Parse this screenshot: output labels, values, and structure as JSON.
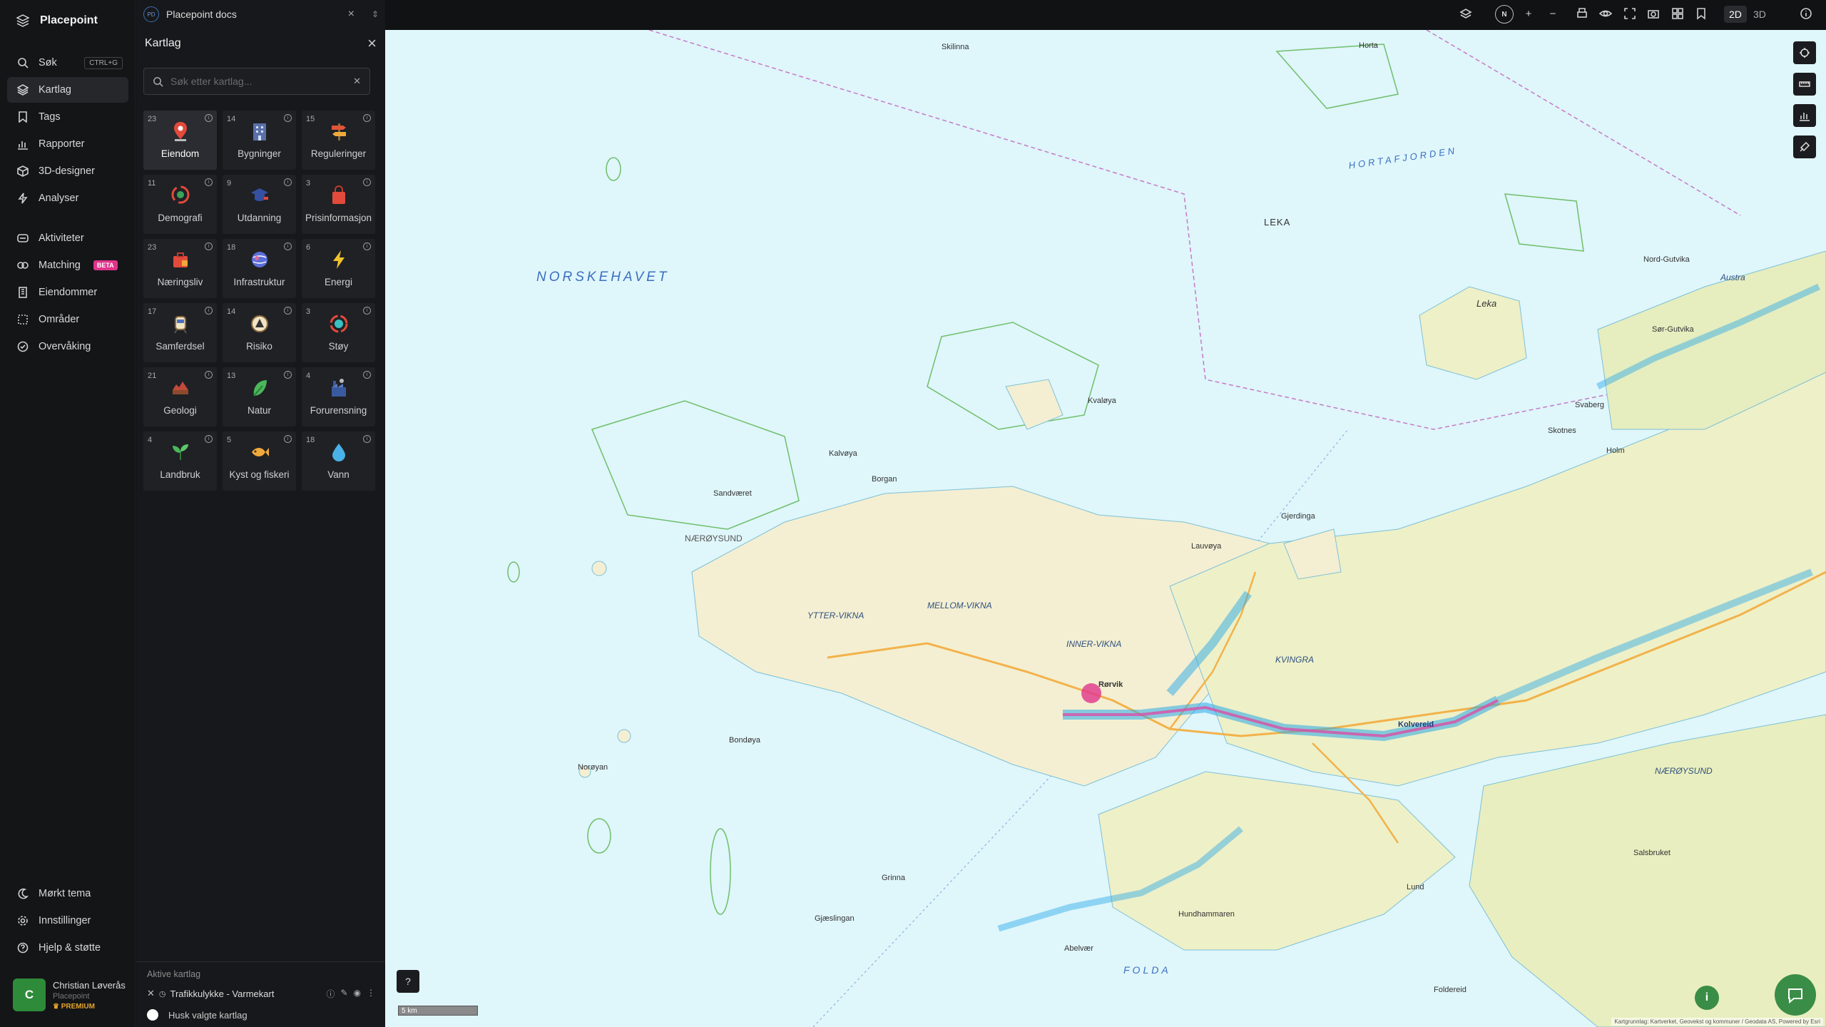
{
  "brand": {
    "name": "Placepoint"
  },
  "nav": {
    "items": [
      {
        "label": "Søk",
        "shortcut": "CTRL+G",
        "icon": "search-icon"
      },
      {
        "label": "Kartlag",
        "icon": "layers-icon",
        "active": true
      },
      {
        "label": "Tags",
        "icon": "bookmark-icon"
      },
      {
        "label": "Rapporter",
        "icon": "bar-chart-icon"
      },
      {
        "label": "3D-designer",
        "icon": "cube-icon"
      },
      {
        "label": "Analyser",
        "icon": "bolt-icon"
      },
      {
        "label": "Aktiviteter",
        "icon": "activity-icon"
      },
      {
        "label": "Matching",
        "badge": "BETA",
        "icon": "match-icon"
      },
      {
        "label": "Eiendommer",
        "icon": "building-icon"
      },
      {
        "label": "Områder",
        "icon": "area-icon"
      },
      {
        "label": "Overvåking",
        "icon": "monitor-icon"
      }
    ],
    "bottom": [
      {
        "label": "Mørkt tema",
        "icon": "moon-icon"
      },
      {
        "label": "Innstillinger",
        "icon": "gear-icon"
      },
      {
        "label": "Hjelp & støtte",
        "icon": "help-icon"
      }
    ]
  },
  "user": {
    "initial": "C",
    "name": "Christian Løverås",
    "org": "Placepoint",
    "tier": "PREMIUM"
  },
  "doc_tab": {
    "badge": "PD",
    "title": "Placepoint docs"
  },
  "panel": {
    "title": "Kartlag",
    "search_placeholder": "Søk etter kartlag...",
    "categories": [
      {
        "count": "23",
        "label": "Eiendom",
        "icon": "pin-icon",
        "selected": true
      },
      {
        "count": "14",
        "label": "Bygninger",
        "icon": "building-icon"
      },
      {
        "count": "15",
        "label": "Reguleringer",
        "icon": "signpost-icon"
      },
      {
        "count": "11",
        "label": "Demografi",
        "icon": "demography-icon"
      },
      {
        "count": "9",
        "label": "Utdanning",
        "icon": "graduation-cap-icon"
      },
      {
        "count": "3",
        "label": "Prisinformasjon",
        "icon": "shopping-bag-icon"
      },
      {
        "count": "23",
        "label": "Næringsliv",
        "icon": "briefcase-icon"
      },
      {
        "count": "18",
        "label": "Infrastruktur",
        "icon": "globe-icon"
      },
      {
        "count": "6",
        "label": "Energi",
        "icon": "lightning-icon"
      },
      {
        "count": "17",
        "label": "Samferdsel",
        "icon": "train-icon"
      },
      {
        "count": "14",
        "label": "Risiko",
        "icon": "hazard-icon"
      },
      {
        "count": "3",
        "label": "Støy",
        "icon": "noise-icon"
      },
      {
        "count": "21",
        "label": "Geologi",
        "icon": "geology-icon"
      },
      {
        "count": "13",
        "label": "Natur",
        "icon": "leaf-icon"
      },
      {
        "count": "4",
        "label": "Forurensning",
        "icon": "factory-icon"
      },
      {
        "count": "4",
        "label": "Landbruk",
        "icon": "plant-icon"
      },
      {
        "count": "5",
        "label": "Kyst og fiskeri",
        "icon": "fish-icon"
      },
      {
        "count": "18",
        "label": "Vann",
        "icon": "water-drop-icon"
      }
    ],
    "active_title": "Aktive kartlag",
    "active_layers": [
      {
        "label": "Trafikkulykke - Varmekart"
      }
    ],
    "remember_label": "Husk valgte kartlag"
  },
  "toolbar": {
    "north": "N",
    "mode_2d": "2D",
    "mode_3d": "3D"
  },
  "map": {
    "sea_labels": [
      "NORSKEHAVET",
      "HORTAFJORDEN",
      "FOLDA"
    ],
    "places": [
      "Horta",
      "Skilinna",
      "LEKA",
      "Leka",
      "Kvaløya",
      "Kalvøya",
      "Borgan",
      "Sandværet",
      "NÆRØYSUND",
      "YTTER-VIKNA",
      "MELLOM-VIKNA",
      "INNER-VIKNA",
      "Rørvik",
      "KVINGRA",
      "Kolvereid",
      "Austra",
      "Bondøya",
      "Norøyan",
      "Grinna",
      "Gjæslingan",
      "Lauvøya",
      "Gjerdinga",
      "Abelvær",
      "NÆRØYSUND",
      "Salsbruket",
      "Lund",
      "Hundhammaren",
      "Foldereid",
      "Nord-Gutvika",
      "Sør-Gutvika",
      "Svaberg",
      "Holm",
      "Skotnes"
    ],
    "scale": "5 km",
    "attribution": "Kartgrunnlag: Kartverket, Geovekst og kommuner / Geodata AS, Powered by Esri"
  },
  "colors": {
    "accent": "#3a8d46",
    "water": "#dff6fb",
    "land": "#f4efd2",
    "heat": "#2aa9e8",
    "nav_bg": "#141517"
  }
}
